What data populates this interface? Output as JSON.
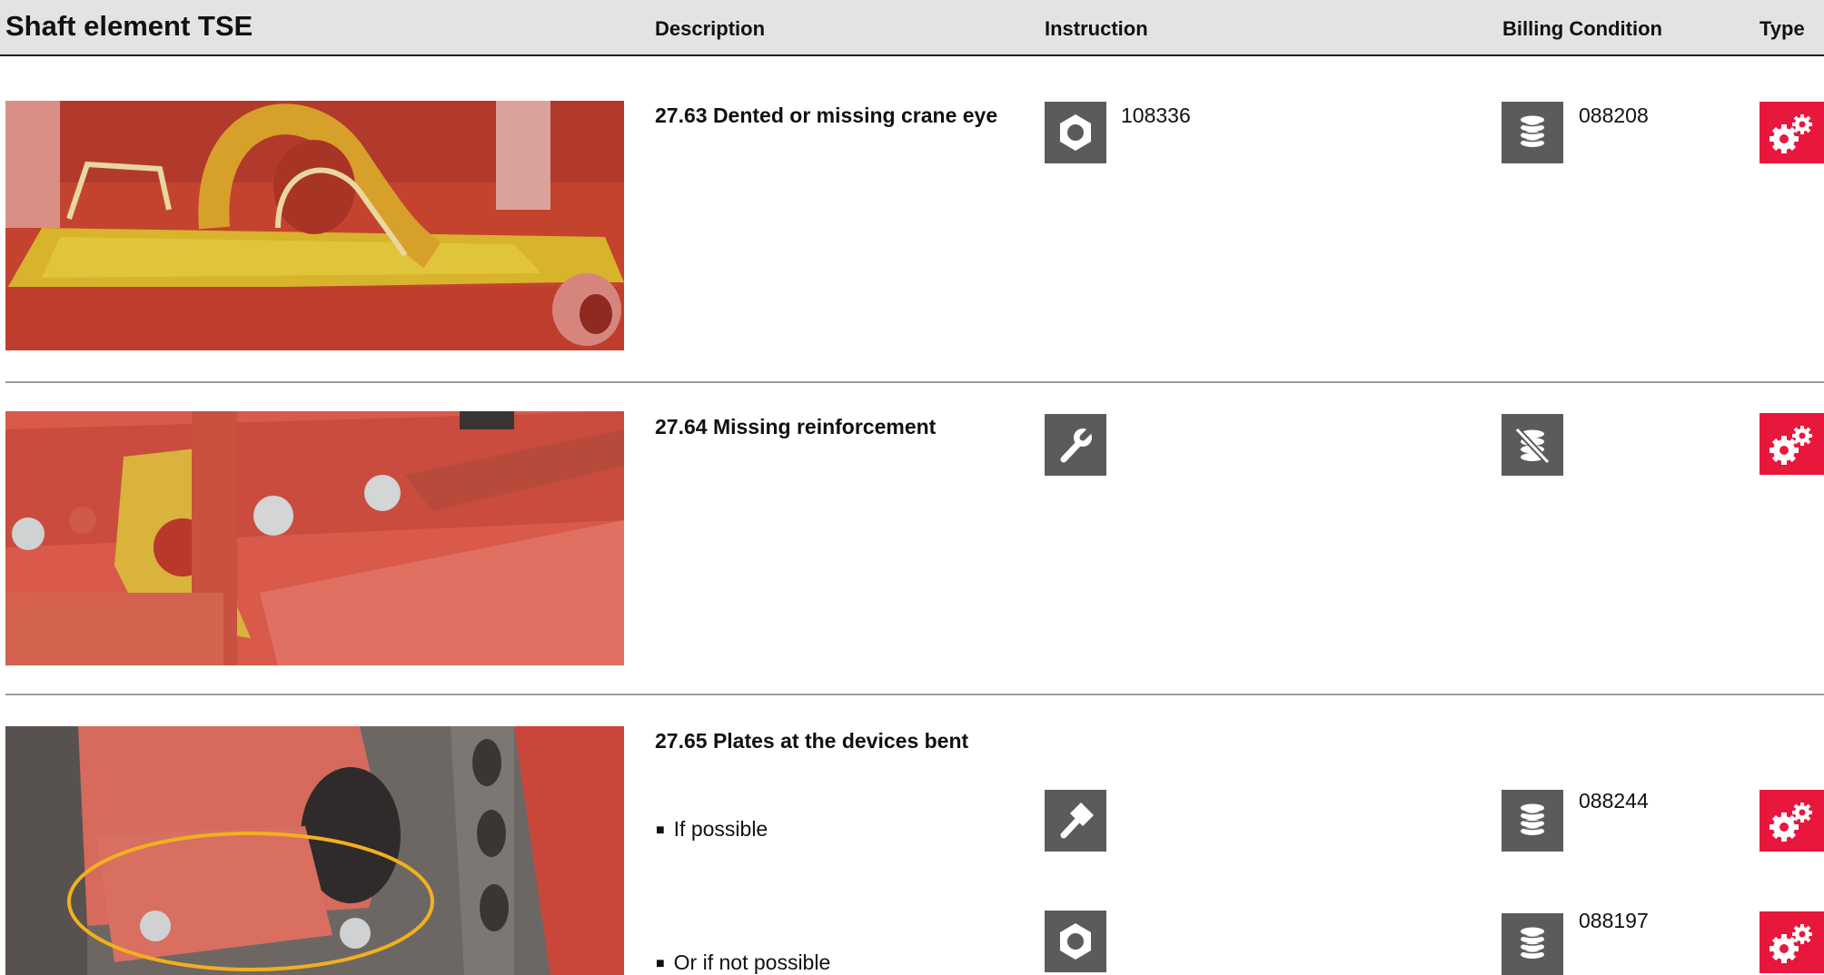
{
  "header": {
    "title": "Shaft element TSE",
    "col_description": "Description",
    "col_instruction": "Instruction",
    "col_billing": "Billing Condition",
    "col_type": "Type"
  },
  "rows": [
    {
      "description": "27.63 Dented or missing crane eye",
      "photo": "dented-crane-eye-photo",
      "instruction": {
        "icon": "nut-icon",
        "number": "108336"
      },
      "billing": {
        "icon": "coins-icon",
        "number": "088208"
      },
      "type": {
        "icon": "gears-icon"
      }
    },
    {
      "description": "27.64 Missing reinforcement",
      "photo": "missing-reinforcement-photo",
      "instruction": {
        "icon": "wrench-icon",
        "number": ""
      },
      "billing": {
        "icon": "no-billing-icon",
        "number": ""
      },
      "type": {
        "icon": "gears-icon"
      }
    },
    {
      "description": "27.65 Plates at the devices bent",
      "photo": "bent-plates-photo",
      "options": [
        {
          "label": "If possible",
          "instruction": {
            "icon": "hammer-icon",
            "number": ""
          },
          "billing": {
            "icon": "coins-icon",
            "number": "088244"
          },
          "type": {
            "icon": "gears-icon"
          }
        },
        {
          "label": "Or if not possible",
          "instruction": {
            "icon": "nut-icon",
            "number": ""
          },
          "billing": {
            "icon": "coins-icon",
            "number": "088197"
          },
          "type": {
            "icon": "gears-icon"
          }
        }
      ]
    }
  ],
  "colors": {
    "header_bg": "#e3e3e3",
    "icon_gray": "#5b5b5b",
    "type_red": "#e8173c",
    "divider": "#9a9a9a"
  }
}
